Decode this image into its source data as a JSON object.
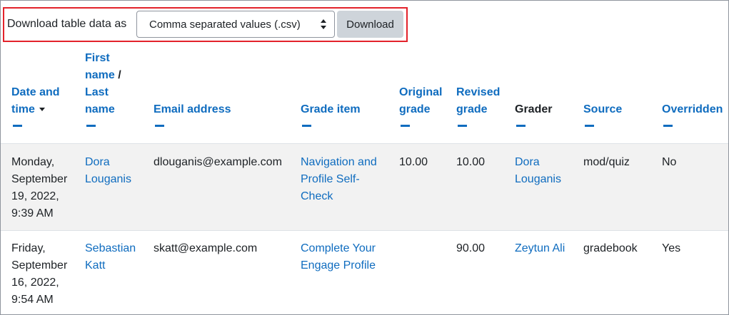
{
  "download": {
    "label": "Download table data as",
    "format_selected": "Comma separated values (.csv)",
    "button_label": "Download"
  },
  "columns": {
    "date_line1": "Date and",
    "date_line2": "time",
    "name_line1": "First",
    "name_line2": "name",
    "name_sep": "/",
    "name_line3": "Last",
    "name_line4": "name",
    "email": "Email address",
    "grade_item": "Grade item",
    "original_line1": "Original",
    "original_line2": "grade",
    "revised_line1": "Revised",
    "revised_line2": "grade",
    "grader": "Grader",
    "source": "Source",
    "overridden": "Overridden"
  },
  "rows": [
    {
      "date_l1": "Monday,",
      "date_l2": "September",
      "date_l3": "19, 2022,",
      "date_l4": "9:39 AM",
      "name_l1": "Dora",
      "name_l2": "Louganis",
      "email": "dlouganis@example.com",
      "item_l1": "Navigation and",
      "item_l2": "Profile Self-",
      "item_l3": "Check",
      "original": "10.00",
      "revised": "10.00",
      "grader_l1": "Dora",
      "grader_l2": "Louganis",
      "source": "mod/quiz",
      "overridden": "No"
    },
    {
      "date_l1": "Friday,",
      "date_l2": "September",
      "date_l3": "16, 2022,",
      "date_l4": "9:54 AM",
      "name_l1": "Sebastian",
      "name_l2": "Katt",
      "email": "skatt@example.com",
      "item_l1": "Complete Your",
      "item_l2": "Engage Profile",
      "original": "",
      "revised": "90.00",
      "grader": "Zeytun Ali",
      "source": "gradebook",
      "overridden": "Yes"
    }
  ],
  "colors": {
    "link": "#0f6cbf",
    "highlight_border": "#e3222b",
    "button_bg": "#ced4da",
    "row_stripe": "#f2f2f2"
  }
}
